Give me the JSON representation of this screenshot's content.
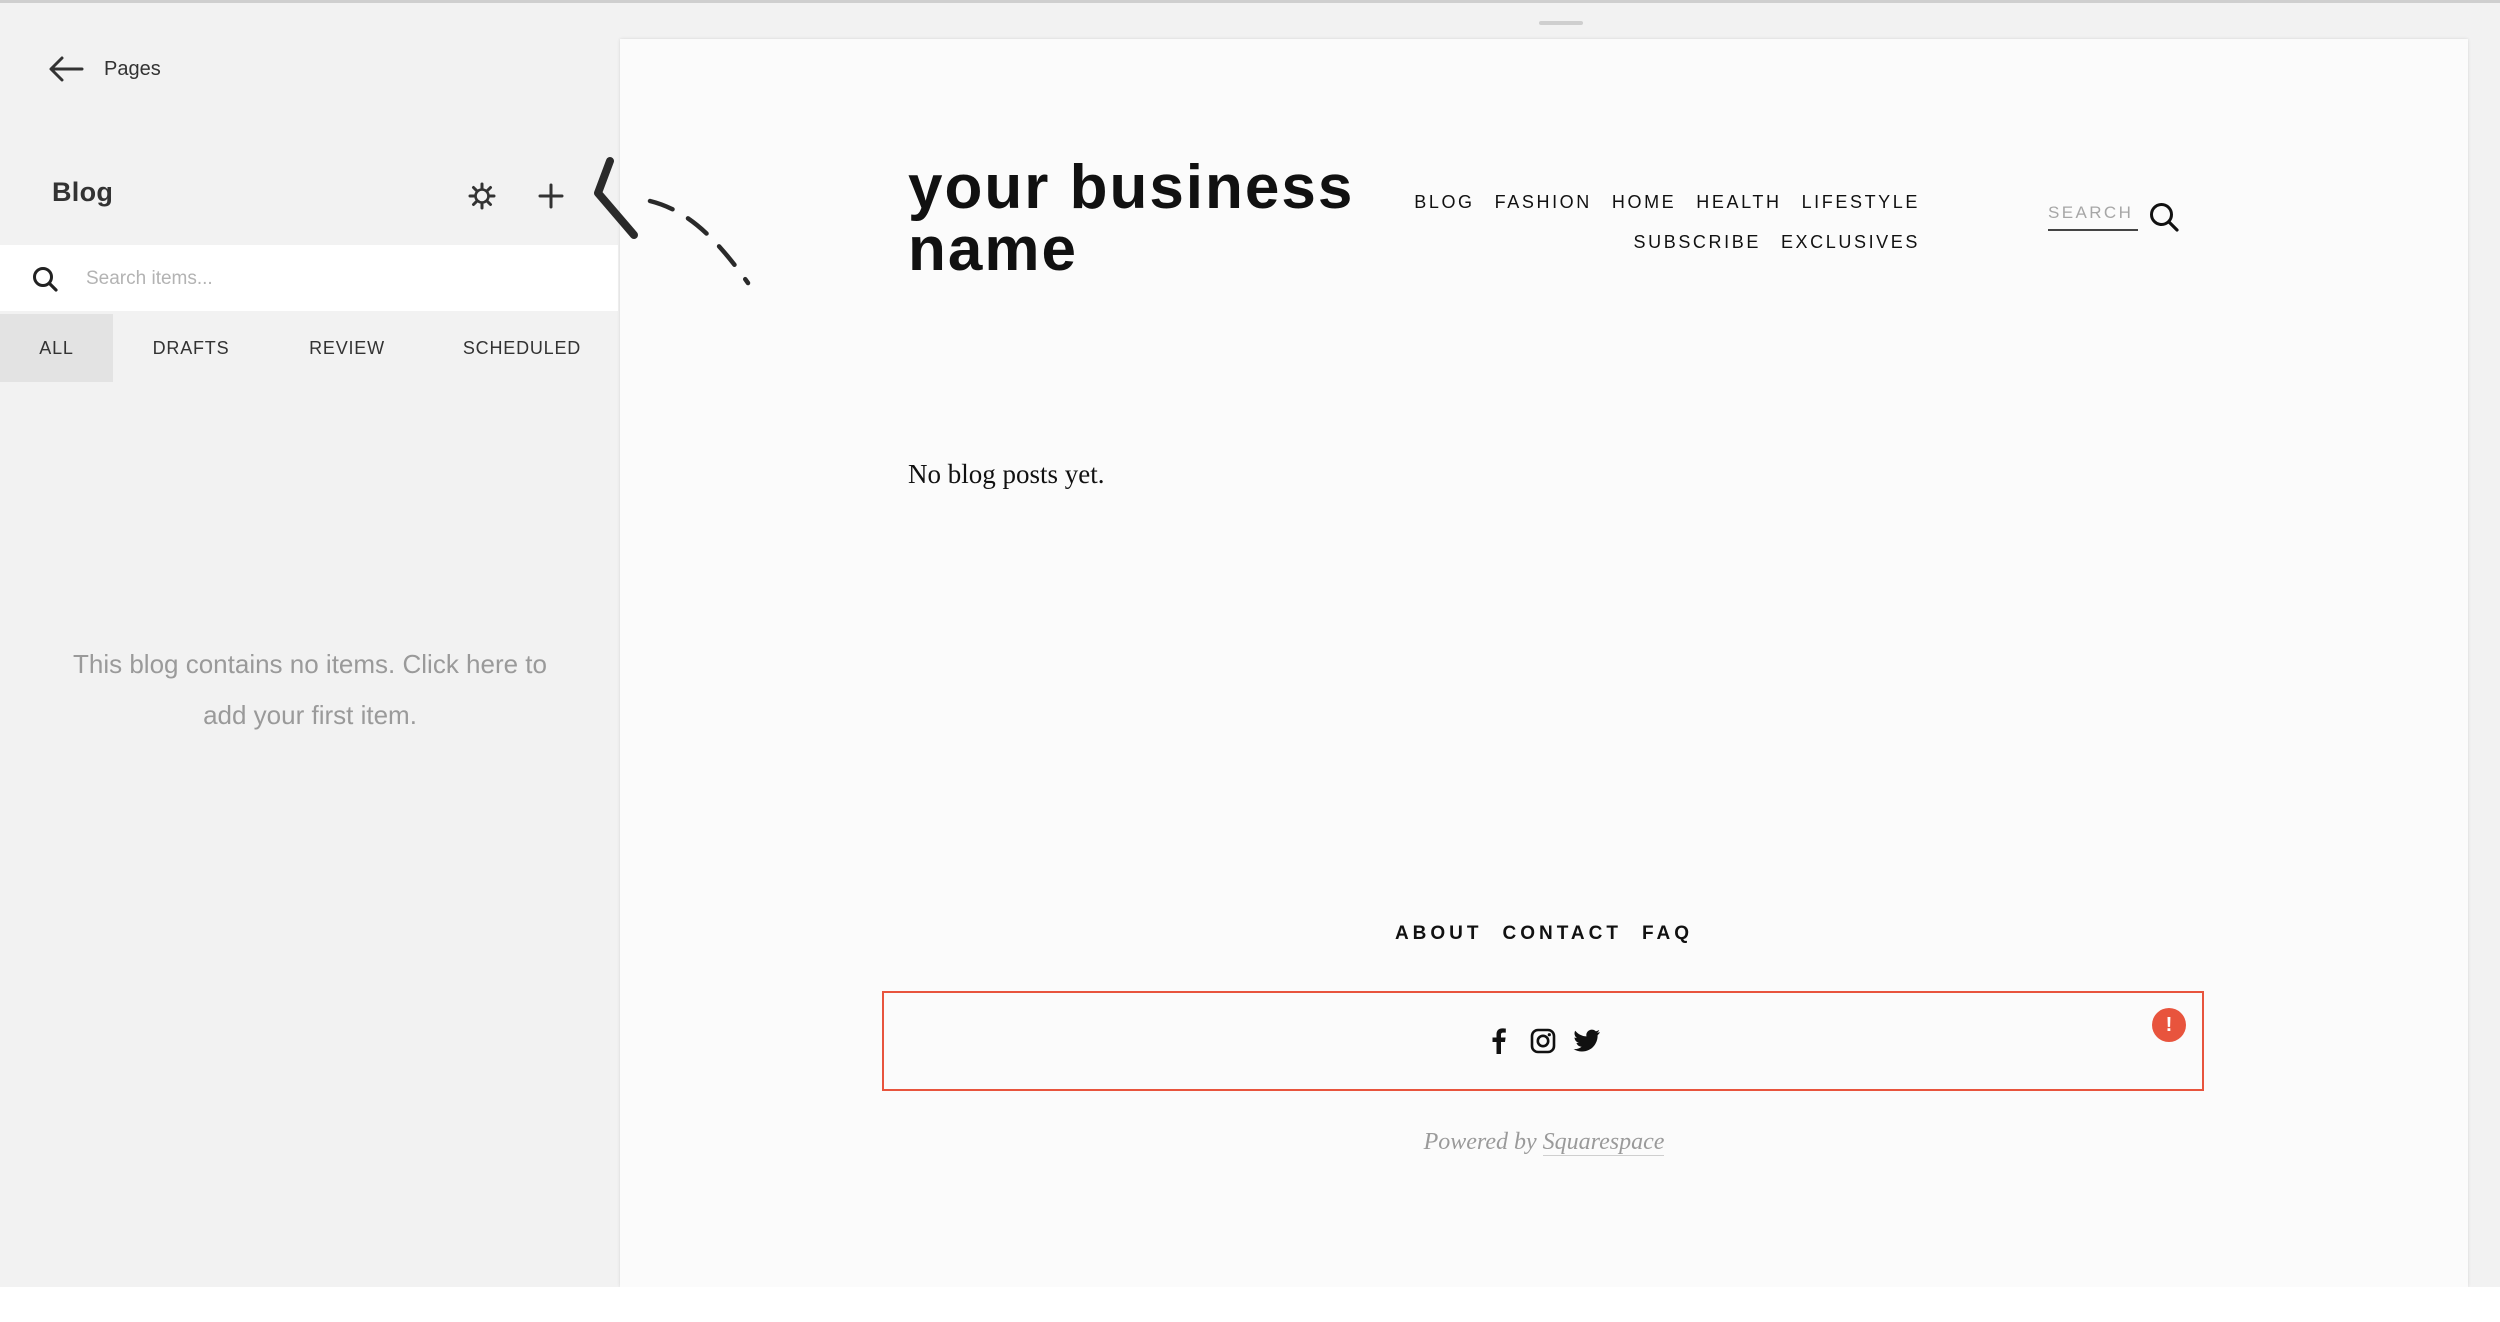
{
  "sidebar": {
    "back_label": "Pages",
    "title": "Blog",
    "search_placeholder": "Search items...",
    "tabs": [
      {
        "label": "ALL",
        "active": true
      },
      {
        "label": "DRAFTS",
        "active": false
      },
      {
        "label": "REVIEW",
        "active": false
      },
      {
        "label": "SCHEDULED",
        "active": false
      }
    ],
    "empty_message": "This blog contains no items. Click here to add your first item."
  },
  "site": {
    "business_name": "your business name",
    "nav_row1": [
      "BLOG",
      "FASHION",
      "HOME",
      "HEALTH",
      "LIFESTYLE"
    ],
    "nav_row2": [
      "SUBSCRIBE",
      "EXCLUSIVES"
    ],
    "search_placeholder": "SEARCH",
    "no_posts": "No blog posts yet.",
    "footer_nav": [
      "ABOUT",
      "CONTACT",
      "FAQ"
    ],
    "alert_symbol": "!",
    "powered_prefix": "Powered by",
    "powered_link": "Squarespace"
  },
  "icons": {
    "back": "arrow-left-icon",
    "settings": "gear-icon",
    "add": "plus-icon",
    "search": "search-icon",
    "social": [
      "facebook-icon",
      "instagram-icon",
      "twitter-icon"
    ]
  },
  "colors": {
    "accent": "#e8543d",
    "panel_bg": "#f2f2f2",
    "preview_bg": "#fbfbfb",
    "active_tab_bg": "#e3e3e3"
  }
}
